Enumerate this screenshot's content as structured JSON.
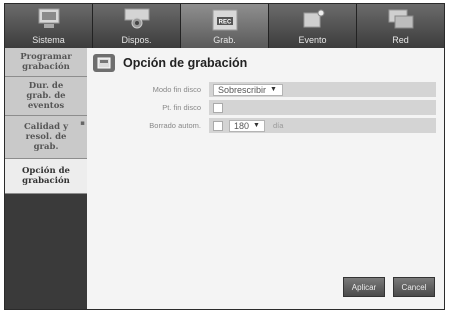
{
  "tabs": [
    {
      "label": "Sistema",
      "icon": "monitor-icon"
    },
    {
      "label": "Dispos.",
      "icon": "camera-icon"
    },
    {
      "label": "Grab.",
      "icon": "rec-icon"
    },
    {
      "label": "Evento",
      "icon": "alarm-icon"
    },
    {
      "label": "Red",
      "icon": "network-icon"
    }
  ],
  "active_tab": "Grab.",
  "sidebar": {
    "items": [
      {
        "label": "Programar\ngrabación"
      },
      {
        "label": "Dur. de\ngrab. de\neventos"
      },
      {
        "label": "Calidad y\nresol. de\ngrab."
      },
      {
        "label": "Opción de\ngrabación"
      }
    ],
    "active_index": 3
  },
  "main": {
    "title": "Opción de grabación",
    "title_icon": "disk-options-icon",
    "rows": {
      "mode": {
        "label": "Modo fin disco",
        "value": "Sobrescribir"
      },
      "beep": {
        "label": "Pt. fin disco"
      },
      "auto_delete": {
        "label": "Borrado autom.",
        "value": "180",
        "unit": "día"
      }
    },
    "apply_label": "Aplicar",
    "cancel_label": "Cancel"
  }
}
